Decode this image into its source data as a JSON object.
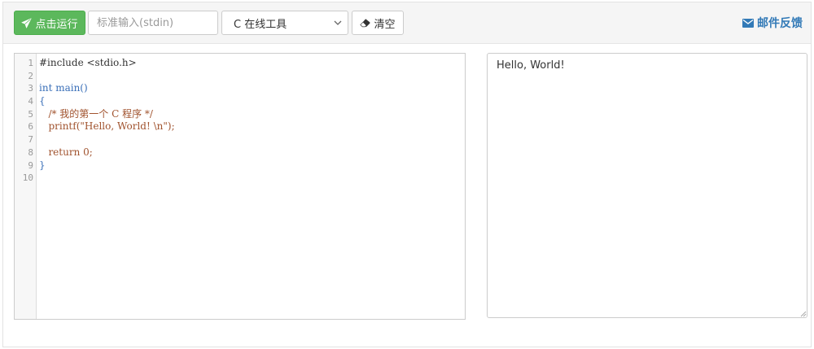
{
  "toolbar": {
    "run_label": "点击运行",
    "stdin_placeholder": "标准输入(stdin)",
    "language_selected": "C 在线工具",
    "clear_label": "清空",
    "feedback_label": "邮件反馈"
  },
  "editor": {
    "line_numbers": [
      "1",
      "2",
      "3",
      "4",
      "5",
      "6",
      "7",
      "8",
      "9",
      "10"
    ],
    "lines": {
      "l1": "#include <stdio.h>",
      "l3_kw": "int",
      "l3_fn": " main()",
      "l4": "{",
      "l5": "   /* 我的第一个 C 程序 */",
      "l6_pre": "   printf(",
      "l6_str": "\"Hello, World! \\n\"",
      "l6_post": ");",
      "l8_kw": "   return",
      "l8_rest": " 0;",
      "l9": "}"
    }
  },
  "output": {
    "text": "Hello, World!"
  },
  "colors": {
    "run_button": "#5cb85c",
    "feedback_link": "#337ab7",
    "keyword": "#3a6fb8",
    "comment": "#a0522d"
  },
  "icons": {
    "run": "paper-plane-icon",
    "clear": "eraser-icon",
    "feedback": "envelope-icon",
    "select": "chevron-down-icon"
  }
}
